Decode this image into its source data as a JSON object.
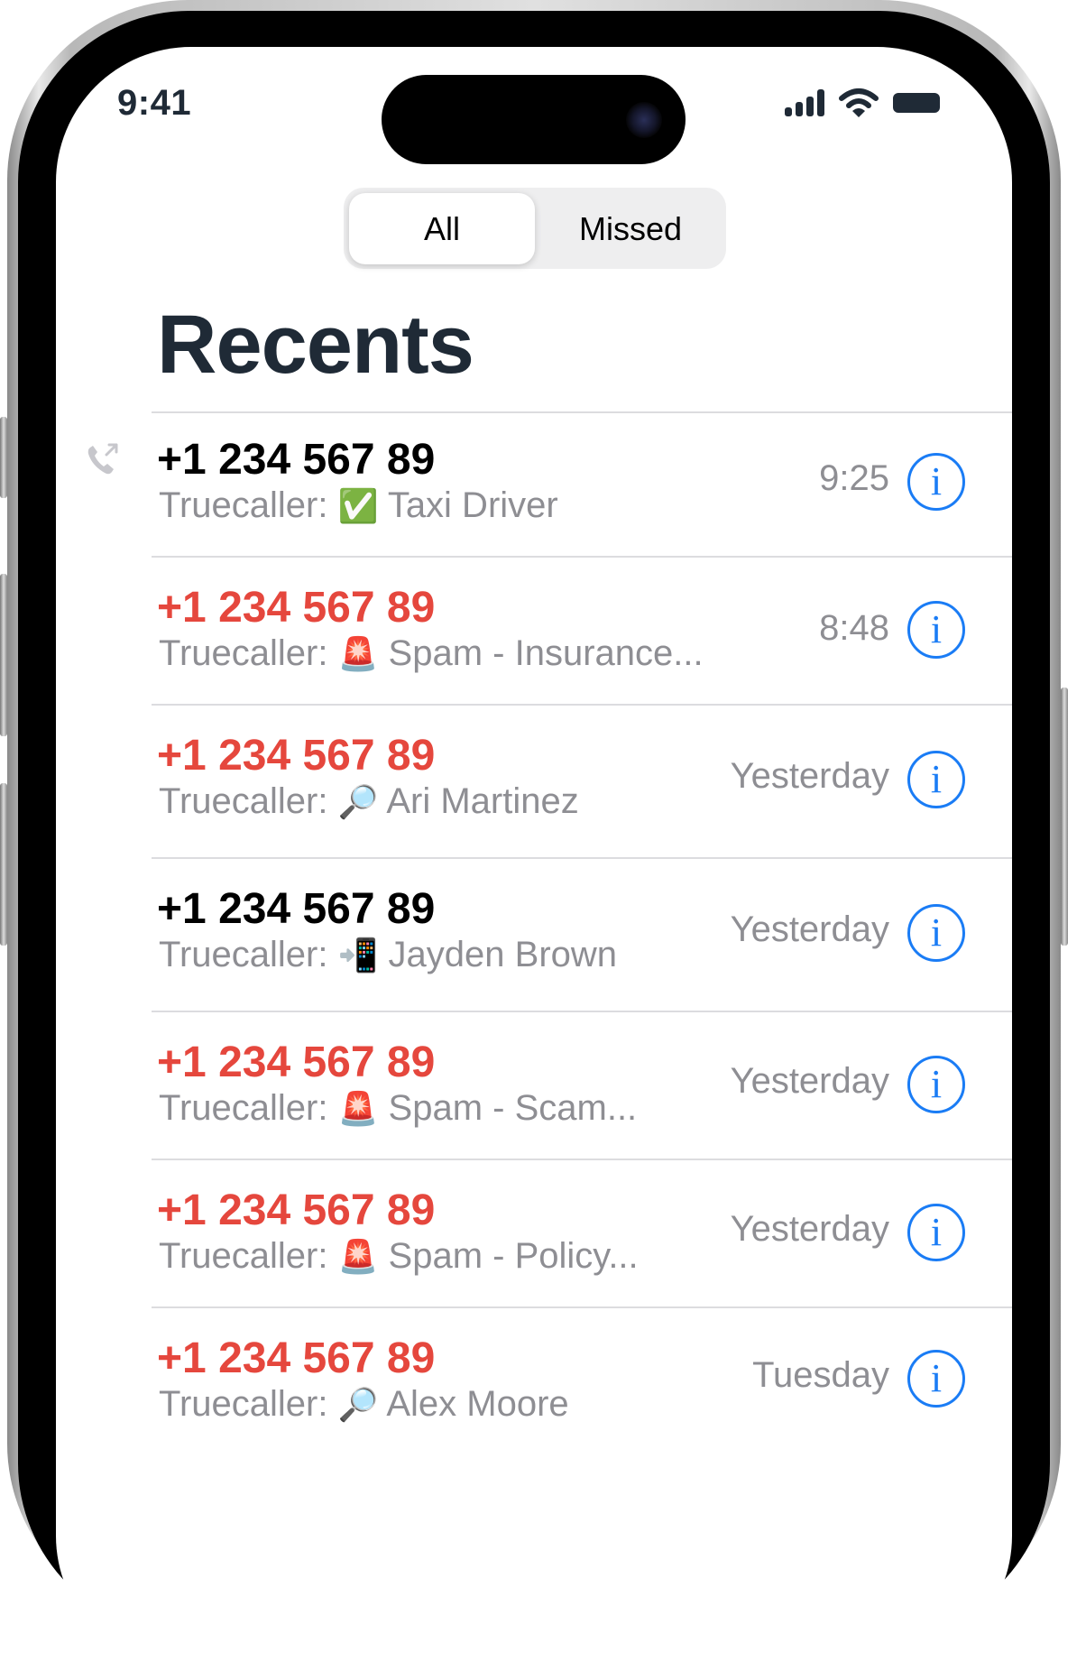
{
  "status_bar": {
    "time": "9:41",
    "icons": [
      "cellular-signal-icon",
      "wifi-icon",
      "battery-icon"
    ]
  },
  "segmented_control": {
    "options": [
      {
        "label": "All",
        "selected": true
      },
      {
        "label": "Missed",
        "selected": false
      }
    ]
  },
  "header": {
    "title": "Recents"
  },
  "colors": {
    "missed": "#e5473d",
    "accent": "#1a7cf5",
    "secondary_text": "#8e8e93",
    "title": "#1f2a36"
  },
  "calls": [
    {
      "number": "+1 234 567 89",
      "prefix": "Truecaller:",
      "emoji": "✅",
      "emoji_name": "check-mark-icon",
      "label": "Taxi Driver",
      "time": "9:25",
      "missed": false,
      "outgoing": true
    },
    {
      "number": "+1 234 567 89",
      "prefix": "Truecaller:",
      "emoji": "🚨",
      "emoji_name": "siren-icon",
      "label": "Spam - Insurance...",
      "time": "8:48",
      "missed": true,
      "outgoing": false
    },
    {
      "number": "+1 234 567 89",
      "prefix": "Truecaller:",
      "emoji": "🔎",
      "emoji_name": "magnifier-icon",
      "label": "Ari Martinez",
      "time": "Yesterday",
      "missed": true,
      "outgoing": false
    },
    {
      "number": "+1 234 567 89",
      "prefix": "Truecaller:",
      "emoji": "📲",
      "emoji_name": "mobile-arrow-icon",
      "label": "Jayden Brown",
      "time": "Yesterday",
      "missed": false,
      "outgoing": false
    },
    {
      "number": "+1 234 567 89",
      "prefix": "Truecaller:",
      "emoji": "🚨",
      "emoji_name": "siren-icon",
      "label": "Spam - Scam...",
      "time": "Yesterday",
      "missed": true,
      "outgoing": false
    },
    {
      "number": "+1 234 567 89",
      "prefix": "Truecaller:",
      "emoji": "🚨",
      "emoji_name": "siren-icon",
      "label": "Spam - Policy...",
      "time": "Yesterday",
      "missed": true,
      "outgoing": false
    },
    {
      "number": "+1 234 567 89",
      "prefix": "Truecaller:",
      "emoji": "🔎",
      "emoji_name": "magnifier-icon",
      "label": "Alex Moore",
      "time": "Tuesday",
      "missed": true,
      "outgoing": false
    }
  ],
  "info_glyph": "i"
}
